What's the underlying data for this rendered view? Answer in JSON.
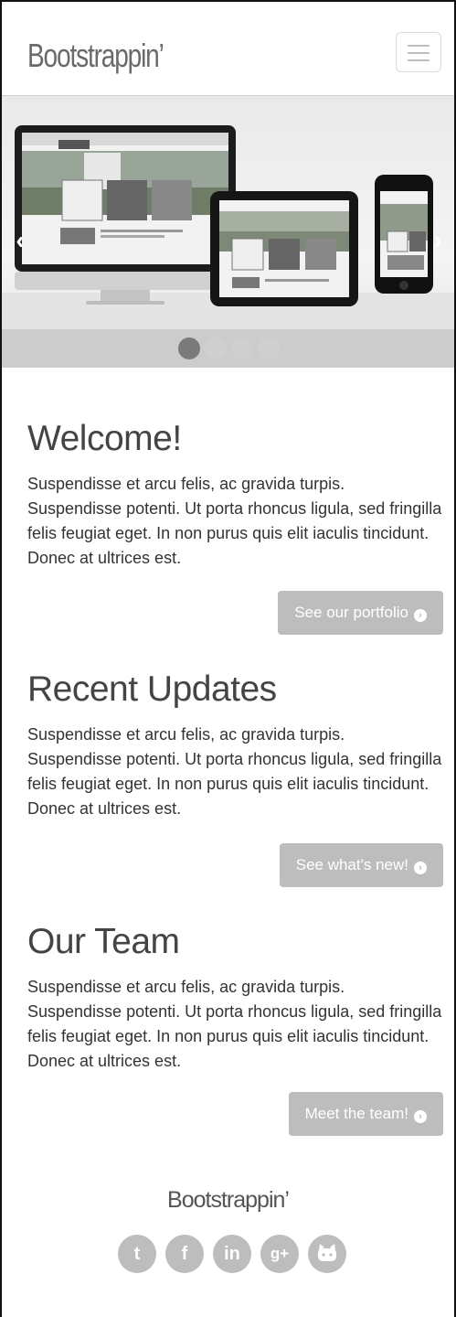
{
  "navbar": {
    "brand": "Bootstrappin’",
    "menu_icon": "hamburger-icon"
  },
  "carousel": {
    "prev_icon": "chevron-left-icon",
    "next_icon": "chevron-right-icon",
    "slide_count": 4,
    "active_index": 0
  },
  "sections": [
    {
      "title": "Welcome!",
      "body": "Suspendisse et arcu felis, ac gravida turpis. Suspendisse potenti. Ut porta rhoncus ligula, sed fringilla felis feugiat eget. In non purus quis elit iaculis tincidunt. Donec at ultrices est.",
      "button": "See our portfolio"
    },
    {
      "title": "Recent Updates",
      "body": "Suspendisse et arcu felis, ac gravida turpis. Suspendisse potenti. Ut porta rhoncus ligula, sed fringilla felis feugiat eget. In non purus quis elit iaculis tincidunt. Donec at ultrices est.",
      "button": "See what's new!"
    },
    {
      "title": "Our Team",
      "body": "Suspendisse et arcu felis, ac gravida turpis. Suspendisse potenti. Ut porta rhoncus ligula, sed fringilla felis feugiat eget. In non purus quis elit iaculis tincidunt. Donec at ultrices est.",
      "button": "Meet the team!"
    }
  ],
  "footer": {
    "brand": "Bootstrappin’",
    "socials": [
      "twitter-icon",
      "facebook-icon",
      "linkedin-icon",
      "google-plus-icon",
      "github-icon"
    ]
  },
  "colors": {
    "button_bg": "#bdbdbd",
    "text": "#333333",
    "heading": "#444444"
  }
}
